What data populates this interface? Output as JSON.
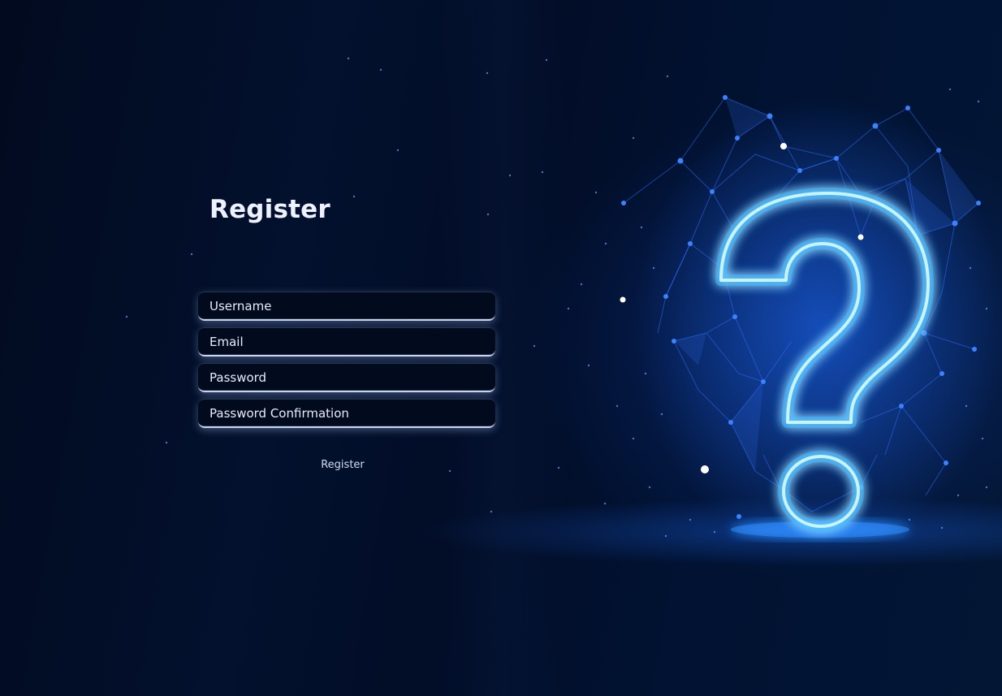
{
  "form": {
    "title": "Register",
    "fields": [
      {
        "name": "username",
        "placeholder": "Username",
        "value": ""
      },
      {
        "name": "email",
        "placeholder": "Email",
        "value": ""
      },
      {
        "name": "password",
        "placeholder": "Password",
        "value": ""
      },
      {
        "name": "password-confirmation",
        "placeholder": "Password Confirmation",
        "value": ""
      }
    ],
    "submit_label": "Register"
  },
  "background": {
    "illustration": "question-mark-icon",
    "colors": {
      "base": "#020d24",
      "glow": "#3fe0ff",
      "network": "#2a6cff"
    }
  }
}
